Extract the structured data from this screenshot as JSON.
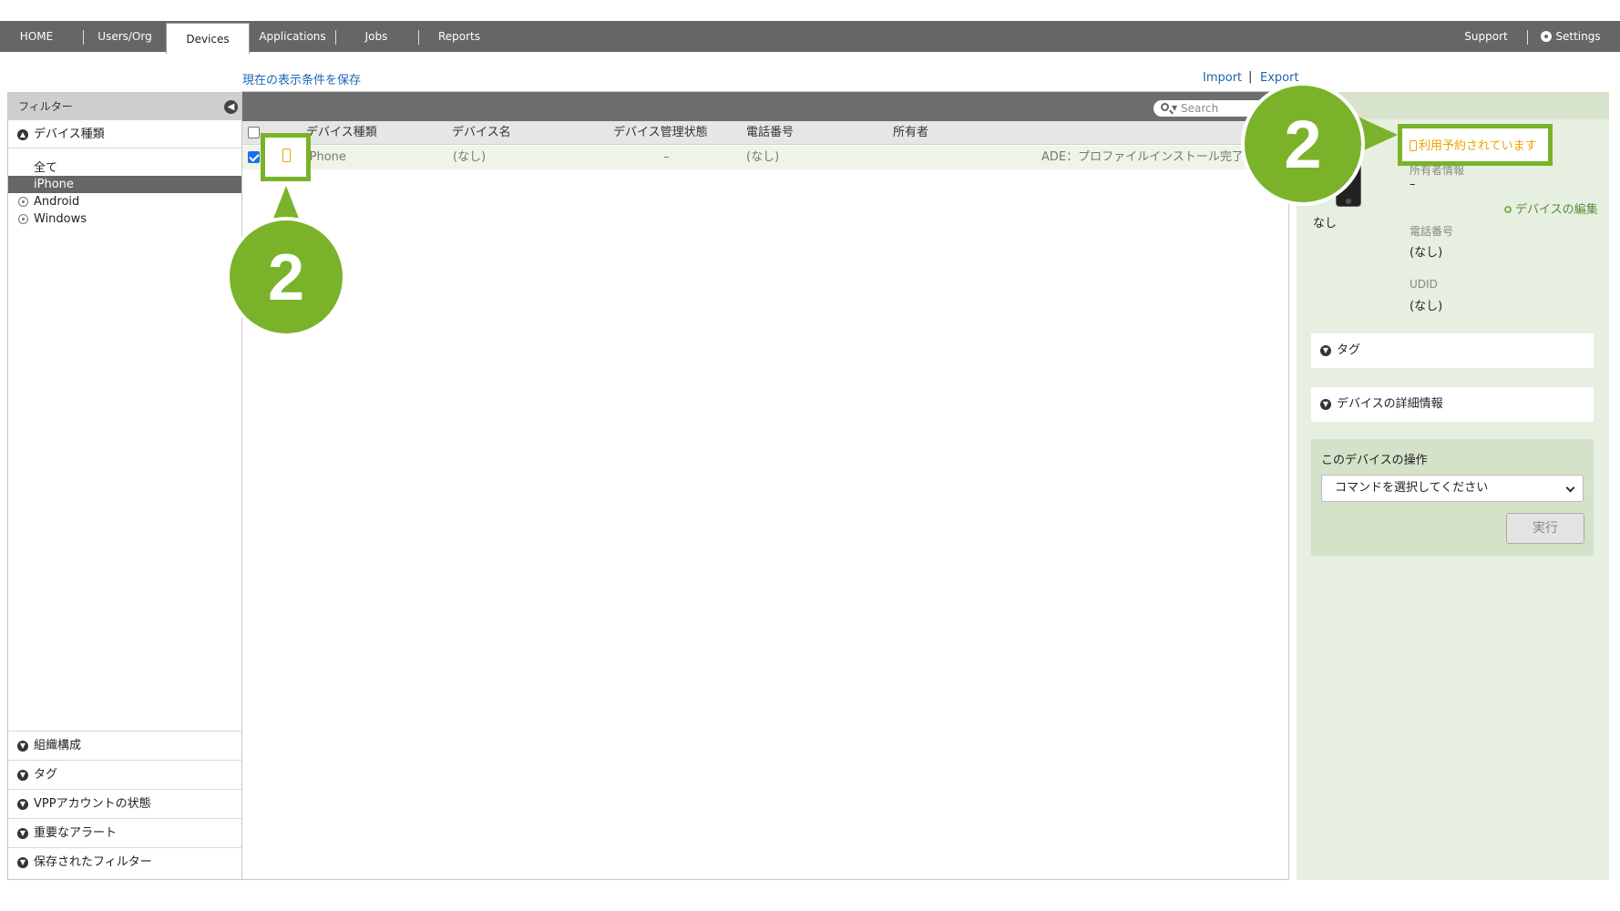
{
  "nav": {
    "items": [
      "HOME",
      "Users/Org",
      "Devices",
      "Applications",
      "Jobs",
      "Reports"
    ],
    "active": "Devices",
    "support": "Support",
    "settings": "Settings"
  },
  "links": {
    "save_view": "現在の表示条件を保存",
    "import": "Import",
    "separator": "|",
    "export": "Export"
  },
  "sidebar": {
    "header": "フィルター",
    "device_type_section": "デバイス種類",
    "device_types": [
      "全て",
      "iPhone",
      "Android",
      "Windows"
    ],
    "selected": "iPhone",
    "bottom_sections": [
      "組織構成",
      "タグ",
      "VPPアカウントの状態",
      "重要なアラート",
      "保存されたフィルター"
    ]
  },
  "search": {
    "placeholder": "Search"
  },
  "table": {
    "headers": [
      "デバイス種類",
      "デバイス名",
      "デバイス管理状態",
      "電話番号",
      "所有者"
    ],
    "rows": [
      {
        "checked": true,
        "device_type": "iPhone",
        "device_name": "(なし)",
        "management_state": "–",
        "phone": "(なし)",
        "owner": "",
        "status": "ADE：プロファイルインストール完了"
      }
    ]
  },
  "detail": {
    "reserved_label": "利用予約されています",
    "owner_info_label": "所有者情報",
    "owner_info_value": "–",
    "edit_device": "デバイスの編集",
    "name_value": "なし",
    "phone_label": "電話番号",
    "phone_value": "(なし)",
    "udid_label": "UDID",
    "udid_value": "(なし)",
    "tags_section": "タグ",
    "details_section": "デバイスの詳細情報",
    "ops_title": "このデバイスの操作",
    "command_select": "コマンドを選択してください",
    "run_button": "実行"
  },
  "callouts": {
    "number": "2"
  },
  "colors": {
    "nav_bg": "#666666",
    "accent_green": "#7ab32a",
    "reserved_orange": "#f0a000",
    "link_blue": "#1a66b3",
    "detail_bg": "#e7efe0"
  }
}
